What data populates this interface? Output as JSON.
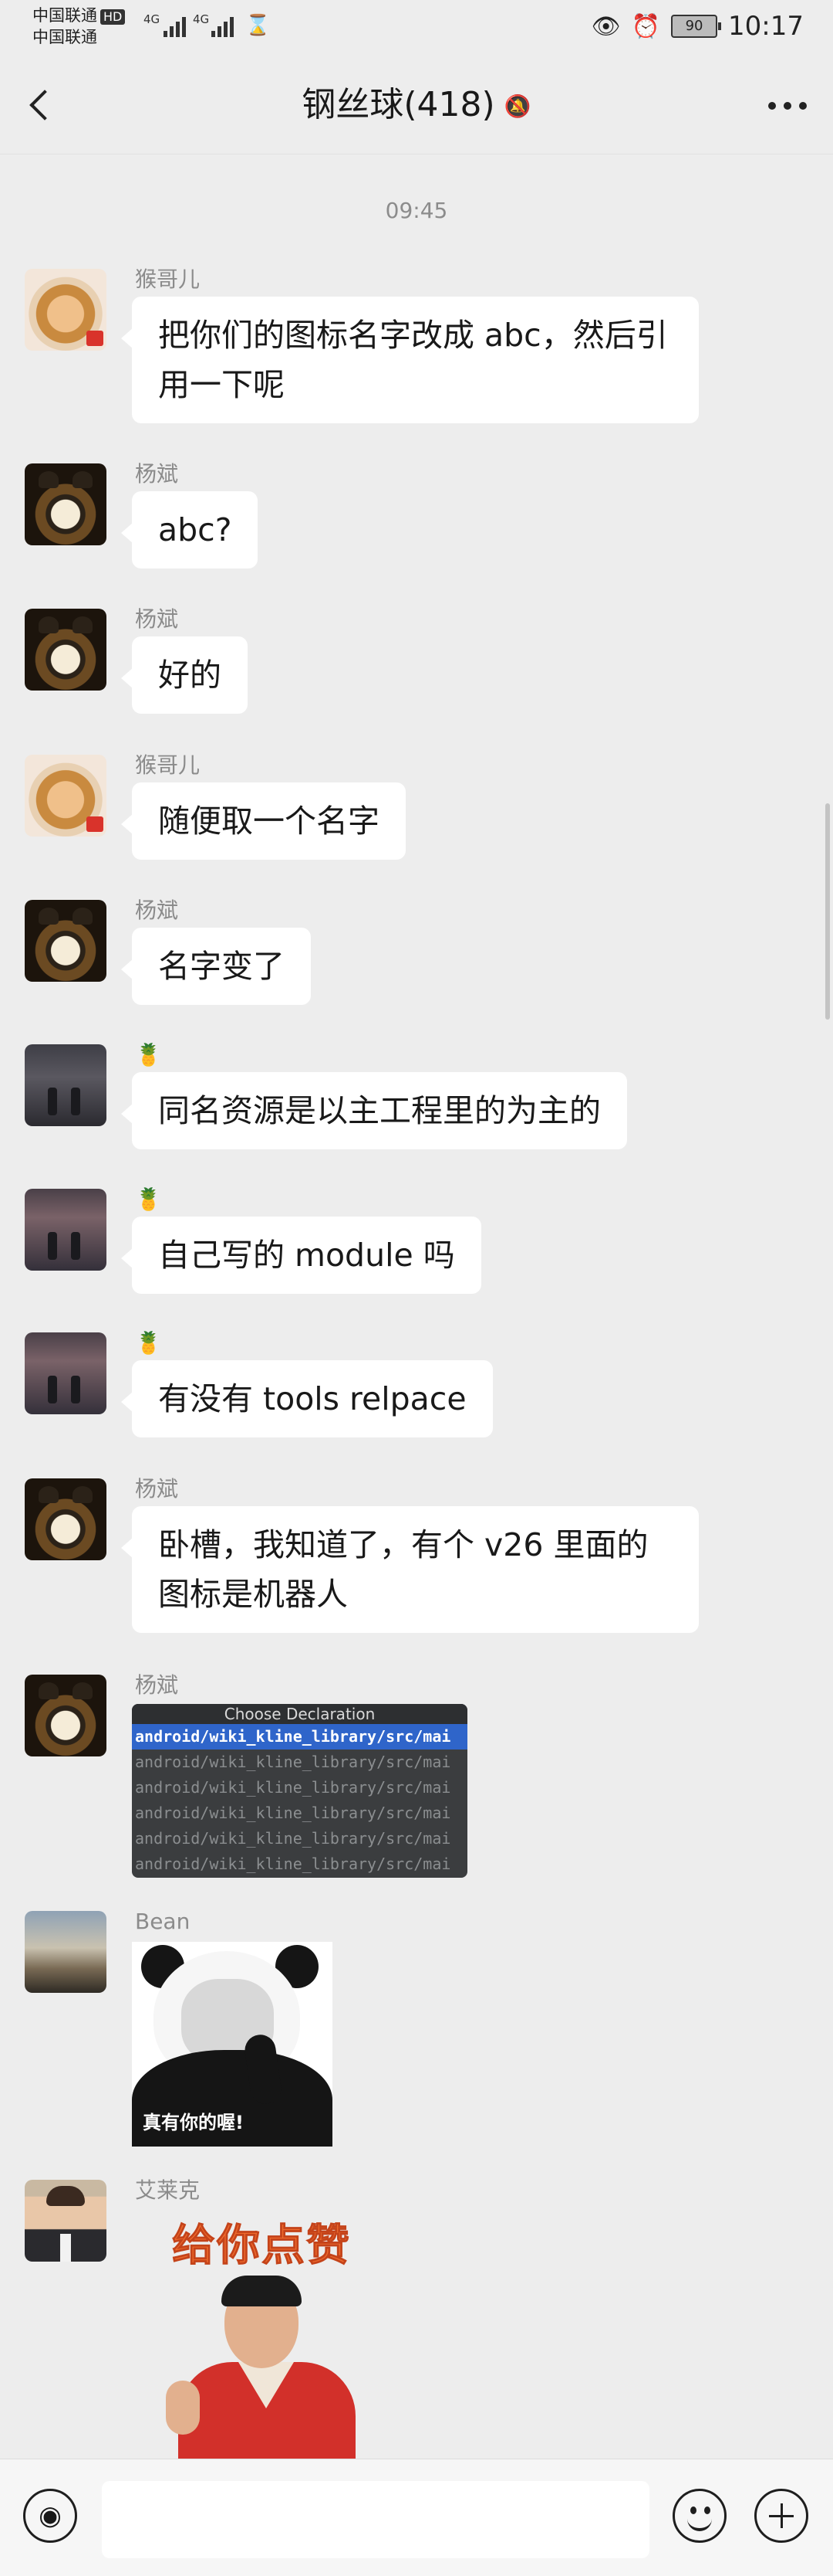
{
  "status_bar": {
    "carrier_1": "中国联通",
    "hd_badge": "HD",
    "carrier_2": "中国联通",
    "network_1": "4G",
    "network_2": "4G",
    "battery": "90",
    "time": "10:17"
  },
  "header": {
    "title": "钢丝球(418)"
  },
  "chat": {
    "timestamp": "09:45",
    "messages": [
      {
        "sender": "猴哥儿",
        "text": "把你们的图标名字改成 abc，然后引用一下呢"
      },
      {
        "sender": "杨斌",
        "text": "abc?"
      },
      {
        "sender": "杨斌",
        "text": "好的"
      },
      {
        "sender": "猴哥儿",
        "text": "随便取一个名字"
      },
      {
        "sender": "杨斌",
        "text": "名字变了"
      },
      {
        "sender": "🍍",
        "text": "同名资源是以主工程里的为主的"
      },
      {
        "sender": "🍍",
        "text": "自己写的 module 吗"
      },
      {
        "sender": "🍍",
        "text": "有没有 tools relpace"
      },
      {
        "sender": "杨斌",
        "text": "卧槽，我知道了，有个 v26 里面的图标是机器人"
      },
      {
        "sender": "杨斌",
        "image": {
          "title": "Choose Declaration",
          "lines": [
            "android/wiki_kline_library/src/mai",
            "android/wiki_kline_library/src/mai",
            "android/wiki_kline_library/src/mai",
            "android/wiki_kline_library/src/mai",
            "android/wiki_kline_library/src/mai",
            "android/wiki_kline_library/src/mai"
          ]
        }
      },
      {
        "sender": "Bean",
        "sticker_caption": "真有你的喔!"
      },
      {
        "sender": "艾莱克",
        "sticker_caption": "给你点赞"
      }
    ]
  },
  "icons": {
    "back": "chevron-left-icon",
    "mute": "bell-off-icon",
    "more": "more-horizontal-icon",
    "voice": "voice-icon",
    "emoji": "emoji-icon",
    "plus": "plus-icon"
  }
}
